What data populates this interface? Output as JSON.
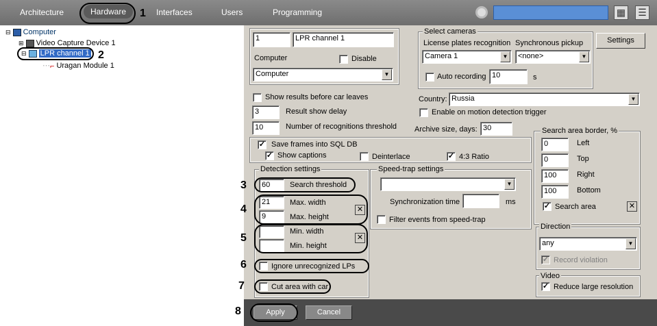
{
  "topbar": {
    "tabs": [
      "Architecture",
      "Hardware",
      "Interfaces",
      "Users",
      "Programming"
    ],
    "icons": [
      "gear-icon",
      "grid-icon",
      "menu-icon"
    ]
  },
  "tree": {
    "root": "Computer",
    "device": "Video Capture Device 1",
    "channel": "LPR channel 1",
    "module": "Uragan Module  1"
  },
  "annotations": [
    "1",
    "2",
    "3",
    "4",
    "5",
    "6",
    "7",
    "8"
  ],
  "form": {
    "id_value": "1",
    "name_value": "LPR channel 1",
    "computer_label": "Computer",
    "disable_label": "Disable",
    "computer_value": "Computer",
    "select_cameras": {
      "legend": "Select cameras",
      "lpr_label": "License plates recognition",
      "sync_label": "Synchronous pickup",
      "camera_value": "Camera 1",
      "sync_value": "<none>",
      "auto_recording_label": "Auto recording",
      "auto_recording_value": "10",
      "seconds": "s"
    },
    "settings_button": "Settings",
    "show_results_label": "Show results before car leaves",
    "result_delay_value": "3",
    "result_delay_label": "Result show delay",
    "recog_threshold_value": "10",
    "recog_threshold_label": "Number of recognitions threshold",
    "country_label": "Country:",
    "country_value": "Russia",
    "motion_trigger_label": "Enable on motion detection trigger",
    "archive_label": "Archive size, days:",
    "archive_value": "30",
    "save_frames_label": "Save frames into SQL DB",
    "show_captions_label": "Show captions",
    "deinterlace_label": "Deinterlace",
    "ratio_label": "4:3 Ratio",
    "search_border": {
      "legend": "Search area border, %",
      "left_value": "0",
      "left_label": "Left",
      "top_value": "0",
      "top_label": "Top",
      "right_value": "100",
      "right_label": "Right",
      "bottom_value": "100",
      "bottom_label": "Bottom",
      "search_area_label": "Search area"
    },
    "detection": {
      "legend": "Detection settings",
      "search_threshold_value": "60",
      "search_threshold_label": "Search threshold",
      "max_width_value": "21",
      "max_width_label": "Max. width",
      "max_height_value": "9",
      "max_height_label": "Max. height",
      "min_width_value": "",
      "min_width_label": "Min. width",
      "min_height_value": "",
      "min_height_label": "Min. height",
      "ignore_label": "Ignore unrecognized LPs",
      "cut_area_label": "Cut area with car"
    },
    "speedtrap": {
      "legend": "Speed-trap settings",
      "select_value": "",
      "sync_time_label": "Synchronization time",
      "sync_time_value": "",
      "ms": "ms",
      "filter_label": "Filter events from speed-trap"
    },
    "direction": {
      "legend": "Direction",
      "value": "any",
      "record_violation_label": "Record violation"
    },
    "video": {
      "legend": "Video",
      "reduce_label": "Reduce large resolution"
    },
    "apply_button": "Apply",
    "cancel_button": "Cancel"
  }
}
